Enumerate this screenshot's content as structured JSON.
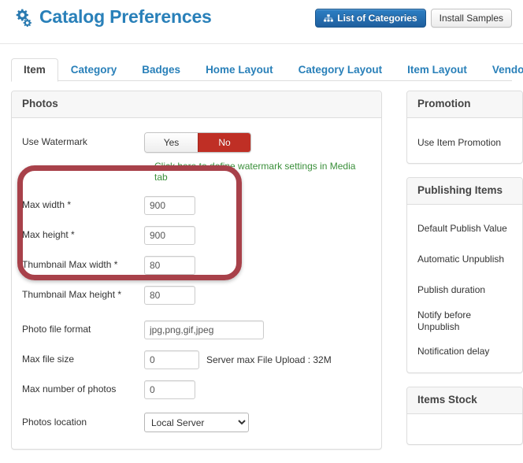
{
  "header": {
    "icon": "cogs-icon",
    "title": "Catalog Preferences",
    "buttons": [
      {
        "label": "List of Categories",
        "icon": "sitemap-icon",
        "style": "primary"
      },
      {
        "label": "Install Samples",
        "icon": "",
        "style": "default"
      }
    ]
  },
  "tabs": [
    {
      "label": "Item",
      "active": true
    },
    {
      "label": "Category",
      "active": false
    },
    {
      "label": "Badges",
      "active": false
    },
    {
      "label": "Home Layout",
      "active": false
    },
    {
      "label": "Category Layout",
      "active": false
    },
    {
      "label": "Item Layout",
      "active": false
    },
    {
      "label": "Vendor Layout",
      "active": false
    }
  ],
  "photos_panel": {
    "title": "Photos",
    "watermark": {
      "label": "Use Watermark",
      "yes_label": "Yes",
      "no_label": "No",
      "selected": "No",
      "link_text": "Click here to define watermark settings in Media tab",
      "link_color": "#3a8f3a",
      "active_color": "#bf2f25"
    },
    "fields": [
      {
        "label": "Max width *",
        "value": "900",
        "size": "xs"
      },
      {
        "label": "Max height *",
        "value": "900",
        "size": "xs"
      },
      {
        "label": "Thumbnail Max width *",
        "value": "80",
        "size": "xs"
      },
      {
        "label": "Thumbnail Max height *",
        "value": "80",
        "size": "xs"
      },
      {
        "label": "Photo file format",
        "value": "jpg,png,gif,jpeg",
        "size": "lg"
      },
      {
        "label": "Max file size",
        "value": "0",
        "size": "sm",
        "note": "Server max File Upload : 32M"
      },
      {
        "label": "Max number of photos",
        "value": "0",
        "size": "xs"
      }
    ],
    "location": {
      "label": "Photos location",
      "value": "Local Server",
      "options": [
        "Local Server"
      ]
    }
  },
  "annotation": {
    "name": "highlight-box",
    "color": "#a8414a"
  },
  "sidebar": {
    "panels": [
      {
        "title": "Promotion",
        "items": [
          {
            "label": "Use Item Promotion"
          }
        ]
      },
      {
        "title": "Publishing Items",
        "items": [
          {
            "label": "Default Publish Value"
          },
          {
            "label": "Automatic Unpublish"
          },
          {
            "label": "Publish duration"
          },
          {
            "label": "Notify before Unpublish"
          },
          {
            "label": "Notification delay"
          }
        ]
      },
      {
        "title": "Items Stock",
        "items": []
      }
    ]
  }
}
